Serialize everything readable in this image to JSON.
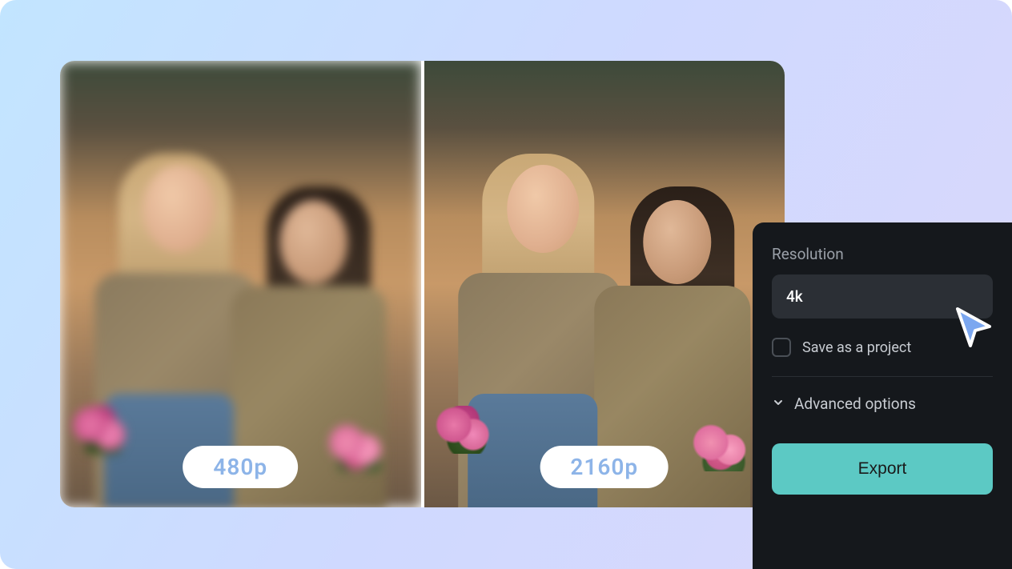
{
  "comparison": {
    "left_badge": "480p",
    "right_badge": "2160p"
  },
  "panel": {
    "resolution_label": "Resolution",
    "resolution_value": "4k",
    "save_project_label": "Save as a project",
    "advanced_label": "Advanced options",
    "export_label": "Export"
  },
  "icons": {
    "cursor": "cursor-pointer-icon",
    "chevron_down": "chevron-down-icon"
  },
  "colors": {
    "accent": "#5cc9c4",
    "panel_bg": "#15181c",
    "badge_text": "#8db4e8"
  }
}
